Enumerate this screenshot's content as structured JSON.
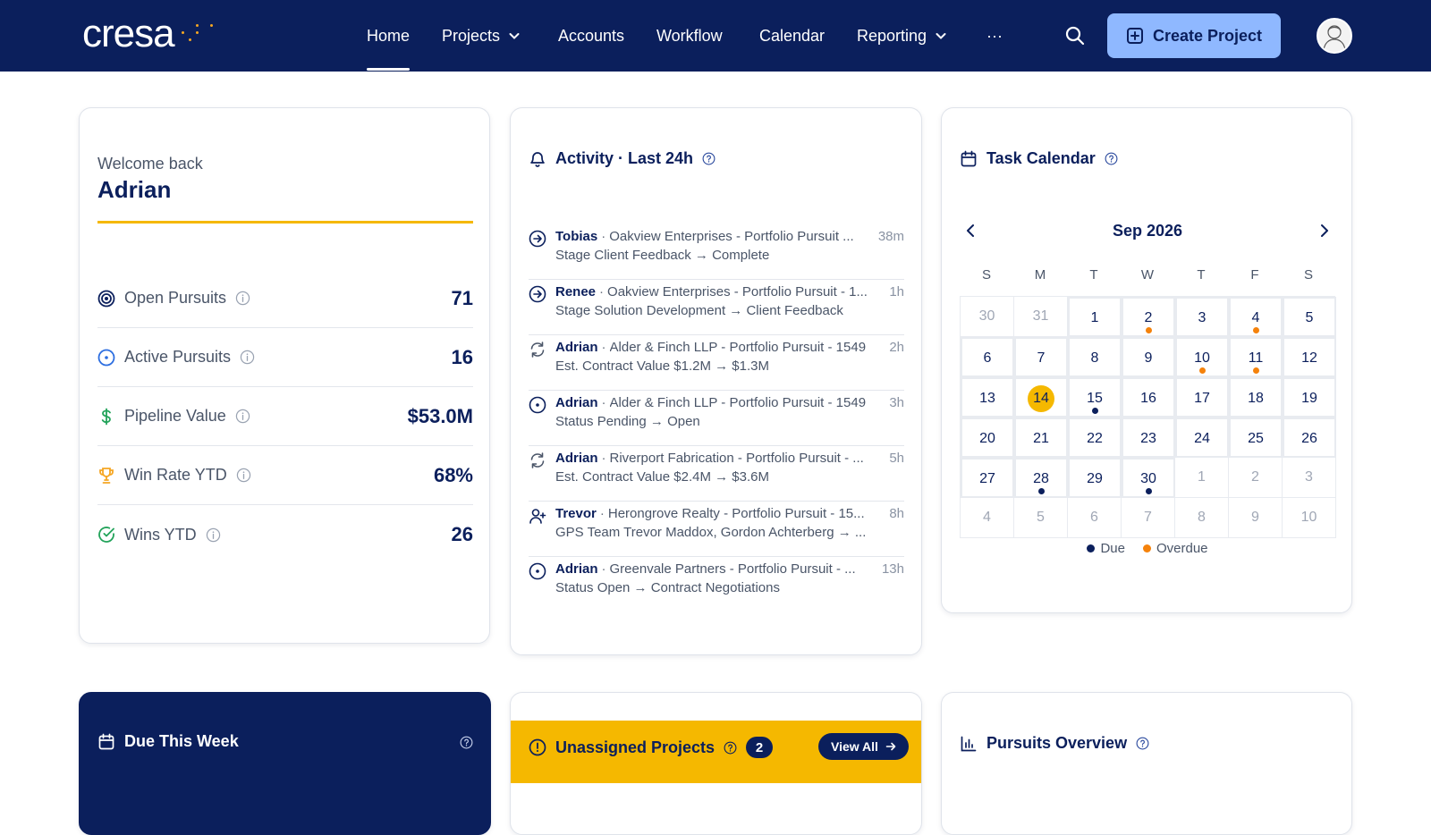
{
  "brand": {
    "logo_text": "cresa",
    "accent": "#f5a623",
    "nav_bg": "#0b1f5c",
    "highlight": "#f5b800"
  },
  "nav": {
    "items": [
      {
        "label": "Home",
        "active": true
      },
      {
        "label": "Projects",
        "has_menu": true
      },
      {
        "label": "Accounts"
      },
      {
        "label": "Workflow"
      },
      {
        "label": "Calendar"
      },
      {
        "label": "Reporting",
        "has_menu": true
      },
      {
        "label": "···"
      }
    ],
    "create_label": "Create Project"
  },
  "welcome": {
    "subtitle": "Welcome back",
    "name": "Adrian",
    "stats": [
      {
        "label": "Open Pursuits",
        "value": "71",
        "icon": "target-icon"
      },
      {
        "label": "Active Pursuits",
        "value": "16",
        "icon": "circle-dot-icon"
      },
      {
        "label": "Pipeline Value",
        "value": "$53.0M",
        "icon": "dollar-icon"
      },
      {
        "label": "Win Rate YTD",
        "value": "68%",
        "icon": "trophy-icon"
      },
      {
        "label": "Wins YTD",
        "value": "26",
        "icon": "check-circle-icon"
      }
    ]
  },
  "activity": {
    "title": "Activity · Last 24h",
    "items": [
      {
        "user": "Tobias",
        "project": "Oakview Enterprises - Portfolio Pursuit ...",
        "time": "38m",
        "detail": "Stage Client Feedback → Complete",
        "icon": "arrow-circle-icon"
      },
      {
        "user": "Renee",
        "project": "Oakview Enterprises - Portfolio Pursuit - 1...",
        "time": "1h",
        "detail": "Stage Solution Development → Client Feedback",
        "icon": "arrow-circle-icon"
      },
      {
        "user": "Adrian",
        "project": "Alder & Finch LLP - Portfolio Pursuit - 1549",
        "time": "2h",
        "detail": "Est. Contract Value $1.2M → $1.3M",
        "icon": "refresh-icon"
      },
      {
        "user": "Adrian",
        "project": "Alder & Finch LLP - Portfolio Pursuit - 1549",
        "time": "3h",
        "detail": "Status Pending → Open",
        "icon": "circle-dot-icon"
      },
      {
        "user": "Adrian",
        "project": "Riverport Fabrication - Portfolio Pursuit - ...",
        "time": "5h",
        "detail": "Est. Contract Value $2.4M → $3.6M",
        "icon": "refresh-icon"
      },
      {
        "user": "Trevor",
        "project": "Herongrove Realty - Portfolio Pursuit - 15...",
        "time": "8h",
        "detail": "GPS Team Trevor Maddox, Gordon Achterberg → ...",
        "icon": "user-plus-icon"
      },
      {
        "user": "Adrian",
        "project": "Greenvale Partners - Portfolio Pursuit - ...",
        "time": "13h",
        "detail": "Status Open → Contract Negotiations",
        "icon": "circle-dot-icon"
      }
    ]
  },
  "calendar": {
    "title": "Task Calendar",
    "month": "Sep 2026",
    "weekdays": [
      "S",
      "M",
      "T",
      "W",
      "T",
      "F",
      "S"
    ],
    "days": [
      {
        "d": "30",
        "muted": true
      },
      {
        "d": "31",
        "muted": true
      },
      {
        "d": "1"
      },
      {
        "d": "2",
        "dot": "overdue"
      },
      {
        "d": "3"
      },
      {
        "d": "4",
        "dot": "overdue"
      },
      {
        "d": "5"
      },
      {
        "d": "6"
      },
      {
        "d": "7"
      },
      {
        "d": "8"
      },
      {
        "d": "9"
      },
      {
        "d": "10",
        "dot": "overdue"
      },
      {
        "d": "11",
        "dot": "overdue"
      },
      {
        "d": "12"
      },
      {
        "d": "13"
      },
      {
        "d": "14",
        "today": true
      },
      {
        "d": "15",
        "dot": "due"
      },
      {
        "d": "16"
      },
      {
        "d": "17"
      },
      {
        "d": "18"
      },
      {
        "d": "19"
      },
      {
        "d": "20"
      },
      {
        "d": "21"
      },
      {
        "d": "22"
      },
      {
        "d": "23"
      },
      {
        "d": "24"
      },
      {
        "d": "25"
      },
      {
        "d": "26"
      },
      {
        "d": "27"
      },
      {
        "d": "28",
        "dot": "due"
      },
      {
        "d": "29"
      },
      {
        "d": "30",
        "dot": "due"
      },
      {
        "d": "1",
        "muted": true
      },
      {
        "d": "2",
        "muted": true
      },
      {
        "d": "3",
        "muted": true
      },
      {
        "d": "4",
        "muted": true
      },
      {
        "d": "5",
        "muted": true
      },
      {
        "d": "6",
        "muted": true
      },
      {
        "d": "7",
        "muted": true
      },
      {
        "d": "8",
        "muted": true
      },
      {
        "d": "9",
        "muted": true
      },
      {
        "d": "10",
        "muted": true
      }
    ],
    "legend": [
      {
        "label": "Due",
        "color": "#0b1f5c"
      },
      {
        "label": "Overdue",
        "color": "#f5820b"
      }
    ]
  },
  "due_week": {
    "title": "Due This Week"
  },
  "unassigned": {
    "title": "Unassigned Projects",
    "count": "2",
    "view_all": "View All"
  },
  "overview": {
    "title": "Pursuits Overview"
  }
}
